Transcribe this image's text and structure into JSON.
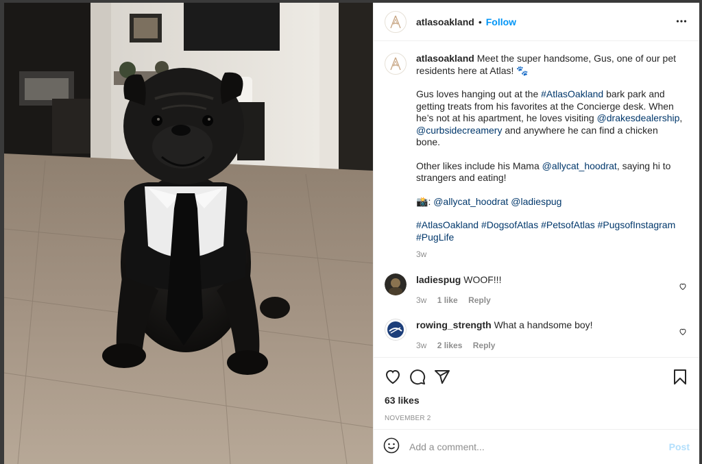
{
  "post": {
    "username": "atlasoakland",
    "follow_label": "Follow",
    "separator": "•",
    "caption": {
      "intro": "Meet the super handsome, Gus, one of our pet residents here at Atlas! 🐾",
      "p2_a": "Gus loves hanging out at the ",
      "p2_tag": "#AtlasOakland",
      "p2_b": " bark park and getting treats from his favorites at the Concierge desk. When he’s not at his apartment, he loves visiting ",
      "p2_m1": "@drakesdealership",
      "p2_c": ", ",
      "p2_m2": "@curbsidecreamery",
      "p2_d": " and anywhere he can find a chicken bone.",
      "p3_a": "Other likes include his Mama ",
      "p3_m": "@allycat_hoodrat",
      "p3_b": ", saying hi to strangers and eating!",
      "p4_emoji": "📸",
      "p4_colon": ": ",
      "p4_m1": "@allycat_hoodrat",
      "p4_m2": "@ladiespug",
      "hashtags": [
        "#AtlasOakland",
        "#DogsofAtlas",
        "#PetsofAtlas",
        "#PugsofInstagram",
        "#PugLife"
      ],
      "time": "3w"
    },
    "comments": [
      {
        "user": "ladiespug",
        "text": "WOOF!!!",
        "time": "3w",
        "likes": "1 like",
        "reply": "Reply"
      },
      {
        "user": "rowing_strength",
        "text": "What a handsome boy!",
        "time": "3w",
        "likes": "2 likes",
        "reply": "Reply"
      }
    ],
    "likes": "63 likes",
    "date": "NOVEMBER 2",
    "add_comment_placeholder": "Add a comment...",
    "post_label": "Post"
  },
  "icons": {
    "like": "heart-icon",
    "comment": "comment-icon",
    "share": "paper-plane-icon",
    "save": "bookmark-icon",
    "more": "more-horizontal-icon",
    "emoji": "smiley-icon"
  },
  "colors": {
    "link": "#00376b",
    "follow": "#0095f6",
    "muted": "#8e8e8e",
    "post_disabled": "#b2dffc"
  }
}
